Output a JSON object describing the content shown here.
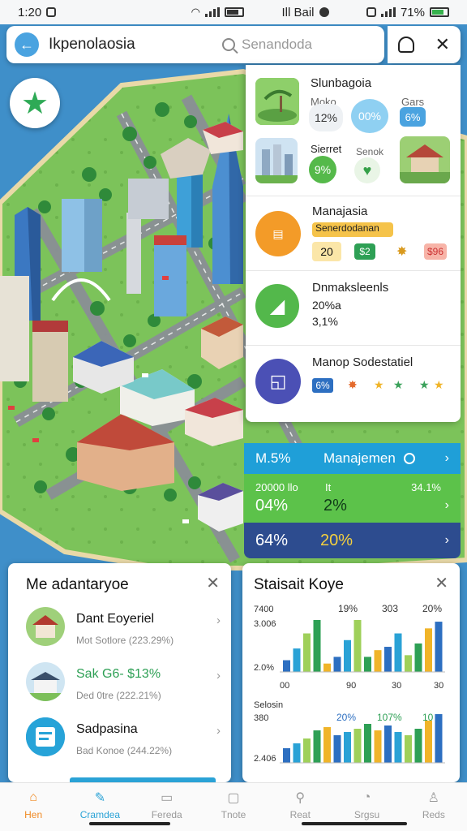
{
  "status": {
    "time": "1:20",
    "center": "Ill Bail",
    "right": "71%"
  },
  "topbar": {
    "title": "Ikpenolaosia",
    "search_placeholder": "Senandoda"
  },
  "panel": {
    "top": {
      "title": "Slunbagoia",
      "label_a": "Moko",
      "label_b": "Gars",
      "chip_a": "12%",
      "chip_b": "00%",
      "chip_c": "6%",
      "label_c": "Sierret",
      "label_d": "Senok",
      "chip_d": "9%"
    },
    "manage": {
      "title": "Manajasia",
      "banner": "Senerdodanan",
      "v1": "20",
      "v2": "$2",
      "v3": "$96"
    },
    "stats": {
      "title": "Dnmaksleenls",
      "line1": "20%a",
      "line2": "3,1%"
    },
    "bottom": {
      "title": "Manop Sodestatiel",
      "chip": "6%"
    }
  },
  "bands": {
    "b1": {
      "left": "M.5%",
      "label": "Manajemen"
    },
    "b2": {
      "left": "20000 llo",
      "mid": "It",
      "right": "34.1%",
      "v1": "04%",
      "v2": "2%"
    },
    "b3": {
      "v1": "64%",
      "v2": "20%"
    }
  },
  "left_card": {
    "title": "Me adantaryoe",
    "items": [
      {
        "name": "Dant Eoyeriel",
        "sub": "Mot Sotlore (223.29%)",
        "color": "#222"
      },
      {
        "name": "Sak G6- $13%",
        "sub": "Ded 0tre (222.21%)",
        "color": "#2ea055"
      },
      {
        "name": "Sadpasina",
        "sub": "Bad Konoe (244.22%)",
        "color": "#222"
      }
    ]
  },
  "right_card": {
    "title": "Staisait Koye",
    "chart1_labels": {
      "y_top": "7400",
      "y_mid": "3.006",
      "y_low": "2.0%",
      "top1": "19%",
      "top2": "303",
      "top3": "20%",
      "x1": "00",
      "x2": "90",
      "x3": "30",
      "x4": "30"
    },
    "chart2_labels": {
      "y_top": "Selosin",
      "y_mid": "380",
      "y_low": "2.406",
      "top1": "20%",
      "top2": "107%",
      "top3": "10"
    }
  },
  "chart_data": [
    {
      "type": "bar",
      "title": "",
      "values": [
        14,
        28,
        46,
        62,
        10,
        18,
        38,
        62,
        18,
        26,
        30,
        46,
        20,
        34,
        52,
        60
      ]
    },
    {
      "type": "bar",
      "title": "",
      "values": [
        18,
        24,
        30,
        40,
        44,
        34,
        38,
        42,
        48,
        40,
        46,
        38,
        34,
        42,
        52,
        60
      ]
    }
  ],
  "nav": [
    "Hen",
    "Cramdea",
    "Fereda",
    "Tnote",
    "Reat",
    "Srgsu",
    "Reds"
  ],
  "colors": {
    "accent": "#4aa3e0",
    "green": "#2eaa56",
    "navy": "#2d4c8f"
  }
}
